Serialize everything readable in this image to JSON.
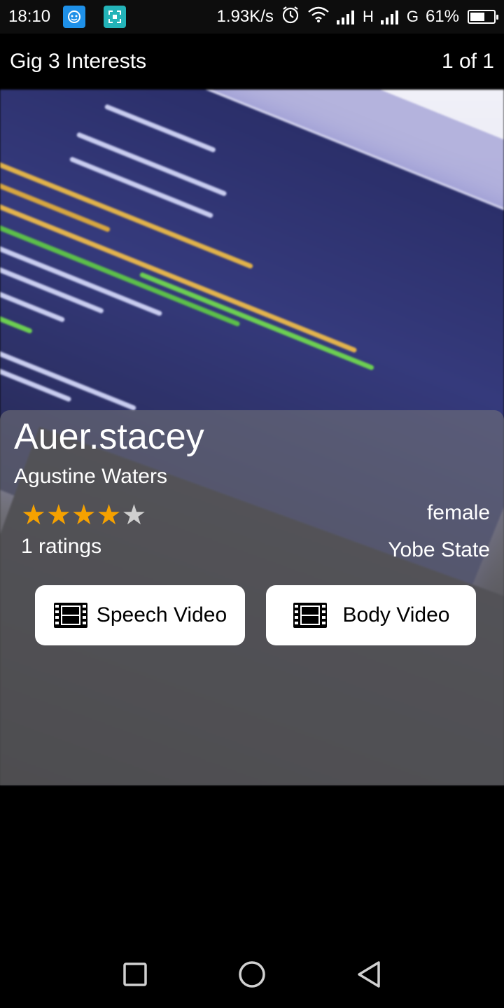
{
  "status_bar": {
    "time": "18:10",
    "network_speed": "1.93K/s",
    "network_type_1": "H",
    "network_type_2": "G",
    "battery_text": "61%",
    "battery_level": 0.61
  },
  "header": {
    "title": "Gig 3 Interests",
    "page_count": "1 of 1"
  },
  "profile": {
    "username": "Auer.stacey",
    "full_name": "Agustine Waters",
    "rating_stars": 4,
    "rating_max": 5,
    "ratings_count": "1 ratings",
    "gender": "female",
    "location": "Yobe State"
  },
  "actions": {
    "speech_video_label": "Speech Video",
    "body_video_label": "Body Video",
    "button_icon": "film-icon"
  },
  "colors": {
    "star_filled": "#f5a100",
    "star_empty": "#cfcfcf",
    "card_overlay": "rgba(120,120,120,0.55)"
  }
}
